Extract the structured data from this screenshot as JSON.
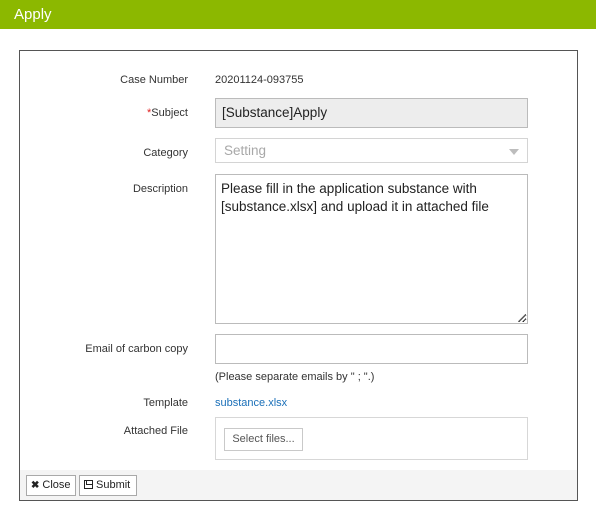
{
  "window": {
    "title": "Apply"
  },
  "form": {
    "case_number": {
      "label": "Case Number",
      "value": "20201124-093755"
    },
    "subject": {
      "required_mark": "*",
      "label": "Subject",
      "value": "[Substance]Apply"
    },
    "category": {
      "label": "Category",
      "placeholder": "Setting",
      "icon": "chevron-down-icon"
    },
    "description": {
      "label": "Description",
      "value": "Please fill in the application substance with [substance.xlsx] and upload it in attached file"
    },
    "email_cc": {
      "label": "Email of carbon copy",
      "value": "",
      "hint": "(Please separate emails by \" ; \".)"
    },
    "template": {
      "label": "Template",
      "link_text": "substance.xlsx"
    },
    "attached_file": {
      "label": "Attached File",
      "button_label": "Select files..."
    }
  },
  "footer": {
    "close_label": "Close",
    "close_icon": "close-icon",
    "submit_label": "Submit",
    "submit_icon": "save-icon"
  },
  "colors": {
    "title_bar": "#8cb800",
    "link": "#1a6fb8",
    "required": "#e02020"
  }
}
